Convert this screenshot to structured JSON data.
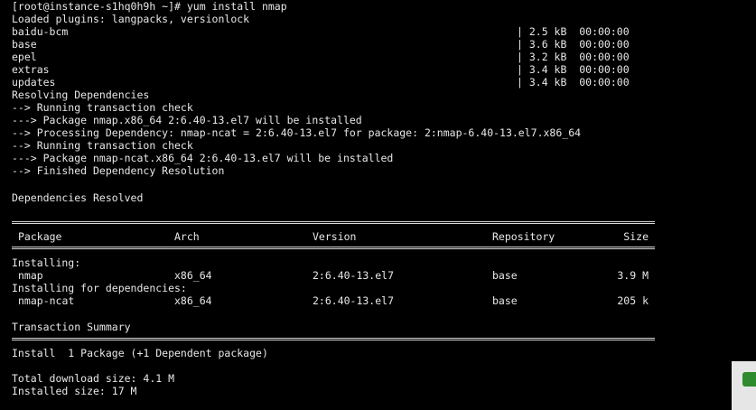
{
  "terminal": {
    "prompt_line": "[root@instance-s1hq0h9h ~]# yum install nmap",
    "plugins_line": "Loaded plugins: langpacks, versionlock",
    "repos": [
      {
        "name": "baidu-bcm",
        "size": "| 2.5 kB  00:00:00"
      },
      {
        "name": "base",
        "size": "| 3.6 kB  00:00:00"
      },
      {
        "name": "epel",
        "size": "| 3.2 kB  00:00:00"
      },
      {
        "name": "extras",
        "size": "| 3.4 kB  00:00:00"
      },
      {
        "name": "updates",
        "size": "| 3.4 kB  00:00:00"
      }
    ],
    "resolve_lines": [
      "Resolving Dependencies",
      "--> Running transaction check",
      "---> Package nmap.x86_64 2:6.40-13.el7 will be installed",
      "--> Processing Dependency: nmap-ncat = 2:6.40-13.el7 for package: 2:nmap-6.40-13.el7.x86_64",
      "--> Running transaction check",
      "---> Package nmap-ncat.x86_64 2:6.40-13.el7 will be installed",
      "--> Finished Dependency Resolution"
    ],
    "deps_resolved": "Dependencies Resolved",
    "table": {
      "headers": {
        "package": "Package",
        "arch": "Arch",
        "version": "Version",
        "repository": "Repository",
        "size": "Size"
      },
      "installing_label": "Installing:",
      "installing_rows": [
        {
          "package": "nmap",
          "arch": "x86_64",
          "version": "2:6.40-13.el7",
          "repository": "base",
          "size": "3.9 M"
        }
      ],
      "deps_label": "Installing for dependencies:",
      "deps_rows": [
        {
          "package": "nmap-ncat",
          "arch": "x86_64",
          "version": "2:6.40-13.el7",
          "repository": "base",
          "size": "205 k"
        }
      ]
    },
    "summary": {
      "title": "Transaction Summary",
      "install_line": "Install  1 Package (+1 Dependent package)",
      "download_size": "Total download size: 4.1 M",
      "installed_size": "Installed size: 17 M"
    }
  },
  "colors": {
    "background": "#000000",
    "text": "#e8e8e8",
    "accent": "#2e8b2e"
  }
}
